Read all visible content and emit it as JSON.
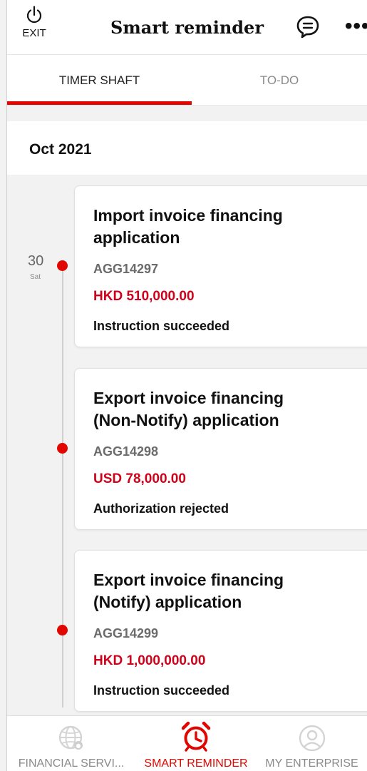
{
  "header": {
    "exit_label": "EXIT",
    "title": "Smart reminder"
  },
  "tabs": [
    {
      "label": "TIMER SHAFT",
      "active": true
    },
    {
      "label": "TO-DO",
      "active": false
    }
  ],
  "month": "Oct 2021",
  "date": {
    "day": "30",
    "weekday": "Sat"
  },
  "items": [
    {
      "title": "Import invoice financing application",
      "ref": "AGG14297",
      "amount": "HKD 510,000.00",
      "status": "Instruction succeeded"
    },
    {
      "title": "Export invoice financing (Non-Notify) application",
      "ref": "AGG14298",
      "amount": "USD 78,000.00",
      "status": "Authorization rejected"
    },
    {
      "title": "Export invoice financing (Notify) application",
      "ref": "AGG14299",
      "amount": "HKD 1,000,000.00",
      "status": "Instruction succeeded"
    }
  ],
  "bottom_nav": [
    {
      "label": "FINANCIAL SERVI...",
      "icon": "globe-icon",
      "active": false
    },
    {
      "label": "SMART REMINDER",
      "icon": "alarm-clock-icon",
      "active": true
    },
    {
      "label": "MY ENTERPRISE",
      "icon": "user-icon",
      "active": false
    }
  ],
  "colors": {
    "accent": "#e10600",
    "amount": "#d0021b",
    "inactive": "#8a8a8a"
  }
}
